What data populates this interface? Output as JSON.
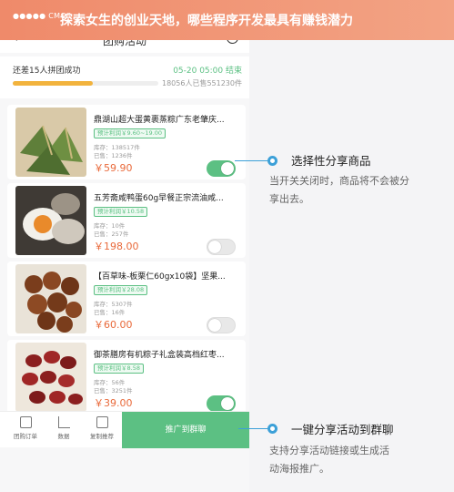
{
  "banner": {
    "carrier": "●●●●● CMCC",
    "headline": "探索女生的创业天地，哪些程序开发最具有赚钱潜力"
  },
  "nav": {
    "back_icon": "chevron-left-icon",
    "title": "团购活动",
    "more_icon": "more-dots-icon",
    "target_icon": "target-icon"
  },
  "progress": {
    "left_text": "还差15人拼团成功",
    "right_text": "05-20 05:00 结束",
    "sub_text": "18056人已售551230件",
    "fraction": 0.55
  },
  "items": [
    {
      "name": "鼎湖山超大蛋黄裹蒸粽广东老肇庆...",
      "tag": "预计利润￥9.60~19.00",
      "stock": "库存：138517件",
      "sold": "已售：1236件",
      "price": "￥59.90",
      "enabled": true
    },
    {
      "name": "五芳斋咸鸭蛋60g早餐正宗流油咸...",
      "tag": "预计利润￥10.58",
      "stock": "库存：10件",
      "sold": "已售：257件",
      "price": "￥198.00",
      "enabled": false
    },
    {
      "name": "【百草味-板栗仁60gx10袋】坚果...",
      "tag": "预计利润￥28.08",
      "stock": "库存：5307件",
      "sold": "已售：16件",
      "price": "￥60.00",
      "enabled": false
    },
    {
      "name": "御茶膳房有机粽子礼盒装高档红枣...",
      "tag": "预计利润￥8.58",
      "stock": "库存：56件",
      "sold": "已售：3251件",
      "price": "￥39.00",
      "enabled": true
    }
  ],
  "bottom": {
    "btn1": "团购订单",
    "btn2": "数据",
    "btn3": "复制推荐",
    "share": "推广到群聊"
  },
  "hints": {
    "h1_title": "选择性分享商品",
    "h1_desc_1": "当开关关闭时，商品将不会被分",
    "h1_desc_2": "享出去。",
    "h2_title": "一键分享活动到群聊",
    "h2_desc_1": "支持分享活动链接或生成活",
    "h2_desc_2": "动海报推广。"
  },
  "colors": {
    "accent": "#5cc083",
    "price": "#e96a3b",
    "hint": "#3ca0d8",
    "banner": "#ef8a6a"
  }
}
